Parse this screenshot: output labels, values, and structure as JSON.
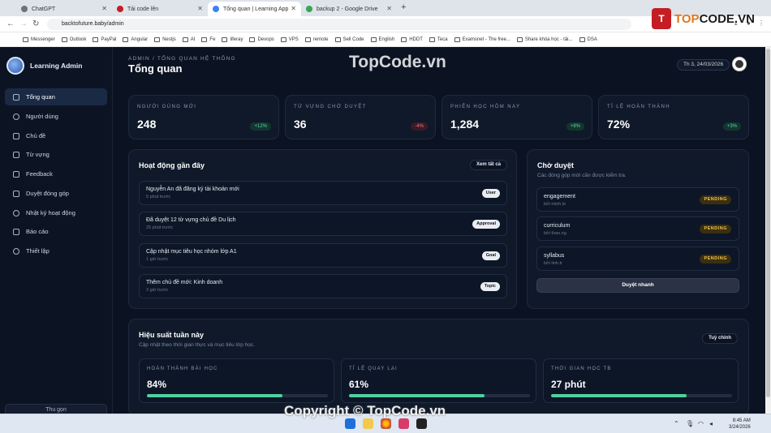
{
  "browser": {
    "tabs": [
      {
        "label": "ChatGPT",
        "color": "#6b7280",
        "active": false
      },
      {
        "label": "Tải code lên",
        "color": "#c41e24",
        "active": false
      },
      {
        "label": "Tổng quan | Learning App",
        "color": "#3b82f6",
        "active": true
      },
      {
        "label": "backup 2 - Google Drive",
        "color": "#34a853",
        "active": false
      }
    ],
    "new_tab": "+",
    "url": "backtofuture.baby/admin",
    "bookmarks": [
      "Messenger",
      "Outlook",
      "PayPal",
      "Angular",
      "Nestjs",
      "AI",
      "Fe",
      "liferay",
      "Devops",
      "VPS",
      "remote",
      "Sell Code",
      "English",
      "HDDT",
      "Teca",
      "Examsnet - The free...",
      "Share khóa học - tải...",
      "DSA"
    ]
  },
  "sidebar": {
    "brand": "Learning Admin",
    "items": [
      {
        "label": "Tổng quan",
        "active": true
      },
      {
        "label": "Người dùng",
        "active": false
      },
      {
        "label": "Chủ đề",
        "active": false
      },
      {
        "label": "Từ vựng",
        "active": false
      },
      {
        "label": "Feedback",
        "active": false
      },
      {
        "label": "Duyệt đóng góp",
        "active": false
      },
      {
        "label": "Nhật ký hoạt động",
        "active": false
      },
      {
        "label": "Báo cáo",
        "active": false
      },
      {
        "label": "Thiết lập",
        "active": false
      }
    ],
    "collapse_label": "Thu gọn"
  },
  "header": {
    "breadcrumb": "ADMIN / TỔNG QUAN HỆ THỐNG",
    "title": "Tổng quan",
    "date": "Th 3, 24/03/2026"
  },
  "stats": [
    {
      "label": "NGƯỜI DÙNG MỚI",
      "value": "248",
      "delta": "+12%",
      "trend": "up"
    },
    {
      "label": "TỪ VỰNG CHỜ DUYỆT",
      "value": "36",
      "delta": "-4%",
      "trend": "down"
    },
    {
      "label": "PHIÊN HỌC HÔM NAY",
      "value": "1,284",
      "delta": "+8%",
      "trend": "up"
    },
    {
      "label": "TỈ LỆ HOÀN THÀNH",
      "value": "72%",
      "delta": "+3%",
      "trend": "up"
    }
  ],
  "activity": {
    "title": "Hoạt động gần đây",
    "view_all": "Xem tất cả",
    "items": [
      {
        "title": "Nguyễn An đã đăng ký tài khoản mới",
        "time": "5 phút trước",
        "tag": "User"
      },
      {
        "title": "Đã duyệt 12 từ vựng chủ đề Du lịch",
        "time": "25 phút trước",
        "tag": "Approval"
      },
      {
        "title": "Cập nhật mục tiêu học nhóm lớp A1",
        "time": "1 giờ trước",
        "tag": "Goal"
      },
      {
        "title": "Thêm chủ đề mới: Kinh doanh",
        "time": "3 giờ trước",
        "tag": "Topic"
      }
    ]
  },
  "pending": {
    "title": "Chờ duyệt",
    "subtitle": "Các đóng góp mới cần được kiểm tra.",
    "items": [
      {
        "word": "engagement",
        "by": "bởi minh.le",
        "status": "PENDING"
      },
      {
        "word": "curriculum",
        "by": "bởi thao.ng",
        "status": "PENDING"
      },
      {
        "word": "syllabus",
        "by": "bởi linh.tr",
        "status": "PENDING"
      }
    ],
    "action": "Duyệt nhanh"
  },
  "performance": {
    "title": "Hiệu suất tuần này",
    "subtitle": "Cập nhật theo thời gian thực và mục tiêu lớp học.",
    "customize": "Tuỳ chỉnh",
    "cards": [
      {
        "label": "HOÀN THÀNH BÀI HỌC",
        "value": "84%",
        "progress": 0.75
      },
      {
        "label": "TỈ LỆ QUAY LẠI",
        "value": "61%",
        "progress": 0.75
      },
      {
        "label": "THỜI GIAN HỌC TB",
        "value": "27 phút",
        "progress": 0.75
      }
    ]
  },
  "taskbar": {
    "time": "8:45 AM",
    "date": "3/24/2026"
  },
  "watermark": {
    "logo_text_1": "TOP",
    "logo_text_2": "CODE.VN",
    "center": "TopCode.vn",
    "bottom": "Copyright © TopCode.vn"
  },
  "colors": {
    "accent_green": "#4fd1a0",
    "pending": "#f3c24a",
    "background": "#0b1322"
  }
}
